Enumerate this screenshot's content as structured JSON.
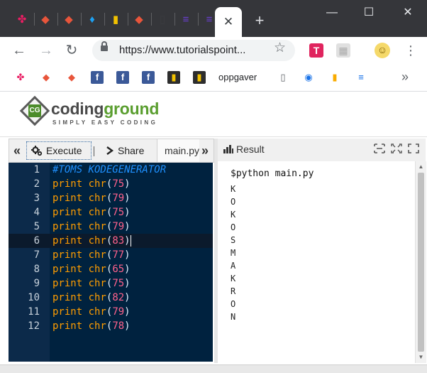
{
  "browser": {
    "tabs": [
      {
        "icon": "tumblr-like-icon",
        "glyph": "✤",
        "color": "#e91e63"
      },
      {
        "icon": "red-bird-icon",
        "glyph": "◆",
        "color": "#e8553b"
      },
      {
        "icon": "red-bird-icon",
        "glyph": "◆",
        "color": "#e8553b"
      },
      {
        "icon": "twitter-icon",
        "glyph": "♦",
        "color": "#1da1f2"
      },
      {
        "icon": "bookmark-app-icon",
        "glyph": "▮",
        "color": "#f2c200"
      },
      {
        "icon": "red-bird-icon",
        "glyph": "◆",
        "color": "#e8553b"
      },
      {
        "icon": "document-icon",
        "glyph": "▯",
        "color": "#3b3c40"
      },
      {
        "icon": "list-app-icon",
        "glyph": "≡",
        "color": "#6a3fd1"
      },
      {
        "icon": "list-app-icon",
        "glyph": "≡",
        "color": "#6a3fd1"
      }
    ],
    "active_tab_close": "✕",
    "new_tab": "+",
    "window_controls": {
      "minimize": "—",
      "maximize": "☐",
      "close": "✕"
    },
    "url": "https://www.tutorialspoint...",
    "back": "←",
    "forward": "→",
    "reload": "↻",
    "star": "☆",
    "menu": "⋮",
    "extensions": [
      {
        "name": "t-extension",
        "label": "T",
        "color": "#e0245e"
      },
      {
        "name": "grid-extension",
        "label": "▦",
        "color": "#e0e0e0"
      },
      {
        "name": "profile-avatar",
        "label": "☺",
        "color": "#f5d96a"
      }
    ]
  },
  "bookmarks": {
    "items": [
      {
        "icon": "pinwheel-icon",
        "glyph": "✤",
        "color": "#e91e63"
      },
      {
        "icon": "red-bird-icon",
        "glyph": "◆",
        "color": "#e8553b"
      },
      {
        "icon": "red-bird-icon",
        "glyph": "◆",
        "color": "#e8553b"
      },
      {
        "icon": "facebook-icon",
        "glyph": "f",
        "color": "#3b5998"
      },
      {
        "icon": "facebook-icon",
        "glyph": "f",
        "color": "#3b5998"
      },
      {
        "icon": "facebook-icon",
        "glyph": "f",
        "color": "#3b5998"
      },
      {
        "icon": "bookmark-app-icon",
        "glyph": "▮",
        "color": "#2d2d2d"
      },
      {
        "icon": "bookmark-app-icon",
        "glyph": "▮",
        "color": "#2d2d2d"
      }
    ],
    "label": "oppgaver",
    "extra_icons": [
      {
        "icon": "page-icon",
        "glyph": "▯",
        "color": "#5f6368"
      },
      {
        "icon": "circle-icon",
        "glyph": "◉",
        "color": "#1a73e8"
      },
      {
        "icon": "analytics-icon",
        "glyph": "▮",
        "color": "#f9ab00"
      },
      {
        "icon": "tag-manager-icon",
        "glyph": "≡",
        "color": "#1a73e8"
      }
    ],
    "more": "»"
  },
  "site": {
    "logo_word_1": "coding",
    "logo_word_2": "ground",
    "logo_tagline": "SIMPLY EASY CODING",
    "logo_mark": "CG"
  },
  "editor": {
    "collapse_left": "«",
    "execute_label": "Execute",
    "share_label": "Share",
    "file_tab": "main.py",
    "collapse_right": "»",
    "comment": "#TOMS KODEGENERATOR",
    "print_kw": "print",
    "fn_name": "chr",
    "lines": [
      {
        "n": "1"
      },
      {
        "n": "2",
        "arg": "75"
      },
      {
        "n": "3",
        "arg": "79"
      },
      {
        "n": "4",
        "arg": "75"
      },
      {
        "n": "5",
        "arg": "79"
      },
      {
        "n": "6",
        "arg": "83"
      },
      {
        "n": "7",
        "arg": "77"
      },
      {
        "n": "8",
        "arg": "65"
      },
      {
        "n": "9",
        "arg": "75"
      },
      {
        "n": "10",
        "arg": "82"
      },
      {
        "n": "11",
        "arg": "79"
      },
      {
        "n": "12",
        "arg": "78"
      }
    ],
    "current_line": 6
  },
  "result": {
    "title": "Result",
    "command": "$python main.py",
    "output": [
      "K",
      "O",
      "K",
      "O",
      "S",
      "M",
      "A",
      "K",
      "R",
      "O",
      "N"
    ]
  },
  "colors": {
    "editor_bg": "#00223f",
    "gutter_bg": "#0c2a4a",
    "keyword": "#ff9d00",
    "number": "#ff628c",
    "comment": "#1e90ff",
    "brand_green": "#5a9e2f"
  }
}
